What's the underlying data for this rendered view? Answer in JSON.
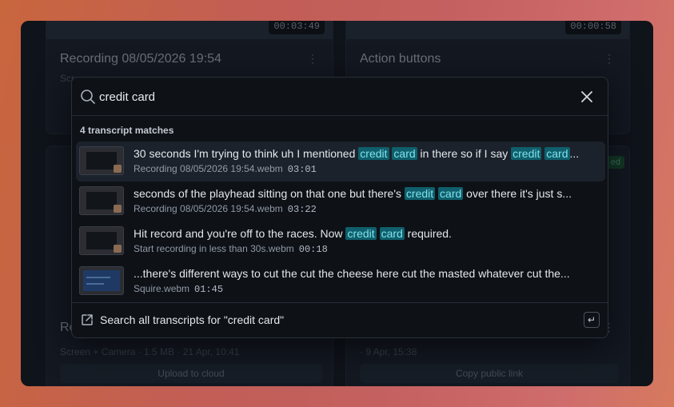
{
  "background_cards": {
    "top_left": {
      "duration": "00:03:49",
      "title": "Recording 08/05/2026 19:54",
      "subtitle": "Scr"
    },
    "top_right": {
      "duration": "00:00:58",
      "title": "Action buttons"
    },
    "bottom_left": {
      "title_fragment": "Re",
      "meta": "Screen + Camera · 1.5 MB · 21 Apr, 10:41",
      "action": "Upload to cloud"
    },
    "bottom_right": {
      "badge": "ed",
      "meta": "· 9 Apr, 15:38",
      "action": "Copy public link"
    }
  },
  "search": {
    "value": "credit card",
    "placeholder": ""
  },
  "results_header": "4 transcript matches",
  "results": [
    {
      "segments": [
        {
          "t": "30 seconds I'm trying to think uh I mentioned ",
          "hl": false
        },
        {
          "t": "credit",
          "hl": true
        },
        {
          "t": " ",
          "hl": false
        },
        {
          "t": "card",
          "hl": true
        },
        {
          "t": " in there so if I say ",
          "hl": false
        },
        {
          "t": "credit",
          "hl": true
        },
        {
          "t": " ",
          "hl": false
        },
        {
          "t": "card",
          "hl": true
        },
        {
          "t": "...",
          "hl": false
        }
      ],
      "file": "Recording 08/05/2026 19:54.webm",
      "time": "03:01",
      "active": true
    },
    {
      "segments": [
        {
          "t": "seconds of the playhead sitting on that one but there's ",
          "hl": false
        },
        {
          "t": "credit",
          "hl": true
        },
        {
          "t": " ",
          "hl": false
        },
        {
          "t": "card",
          "hl": true
        },
        {
          "t": " over there it's just s...",
          "hl": false
        }
      ],
      "file": "Recording 08/05/2026 19:54.webm",
      "time": "03:22",
      "active": false
    },
    {
      "segments": [
        {
          "t": "Hit record and you're off to the races. Now ",
          "hl": false
        },
        {
          "t": "credit",
          "hl": true
        },
        {
          "t": " ",
          "hl": false
        },
        {
          "t": "card",
          "hl": true
        },
        {
          "t": " required.",
          "hl": false
        }
      ],
      "file": "Start recording in less than 30s.webm",
      "time": "00:18",
      "active": false
    },
    {
      "segments": [
        {
          "t": "...there's different ways to cut the cut the cheese here cut the masted whatever cut the...",
          "hl": false
        }
      ],
      "file": "Squire.webm",
      "time": "01:45",
      "active": false,
      "thumb_style": "blue"
    }
  ],
  "footer": {
    "label": "Search all transcripts for \"credit card\"",
    "key_hint": "↵"
  },
  "colors": {
    "highlight_bg": "#0f5f6c",
    "highlight_text": "#7fe0ec",
    "modal_bg": "#0e1116"
  }
}
